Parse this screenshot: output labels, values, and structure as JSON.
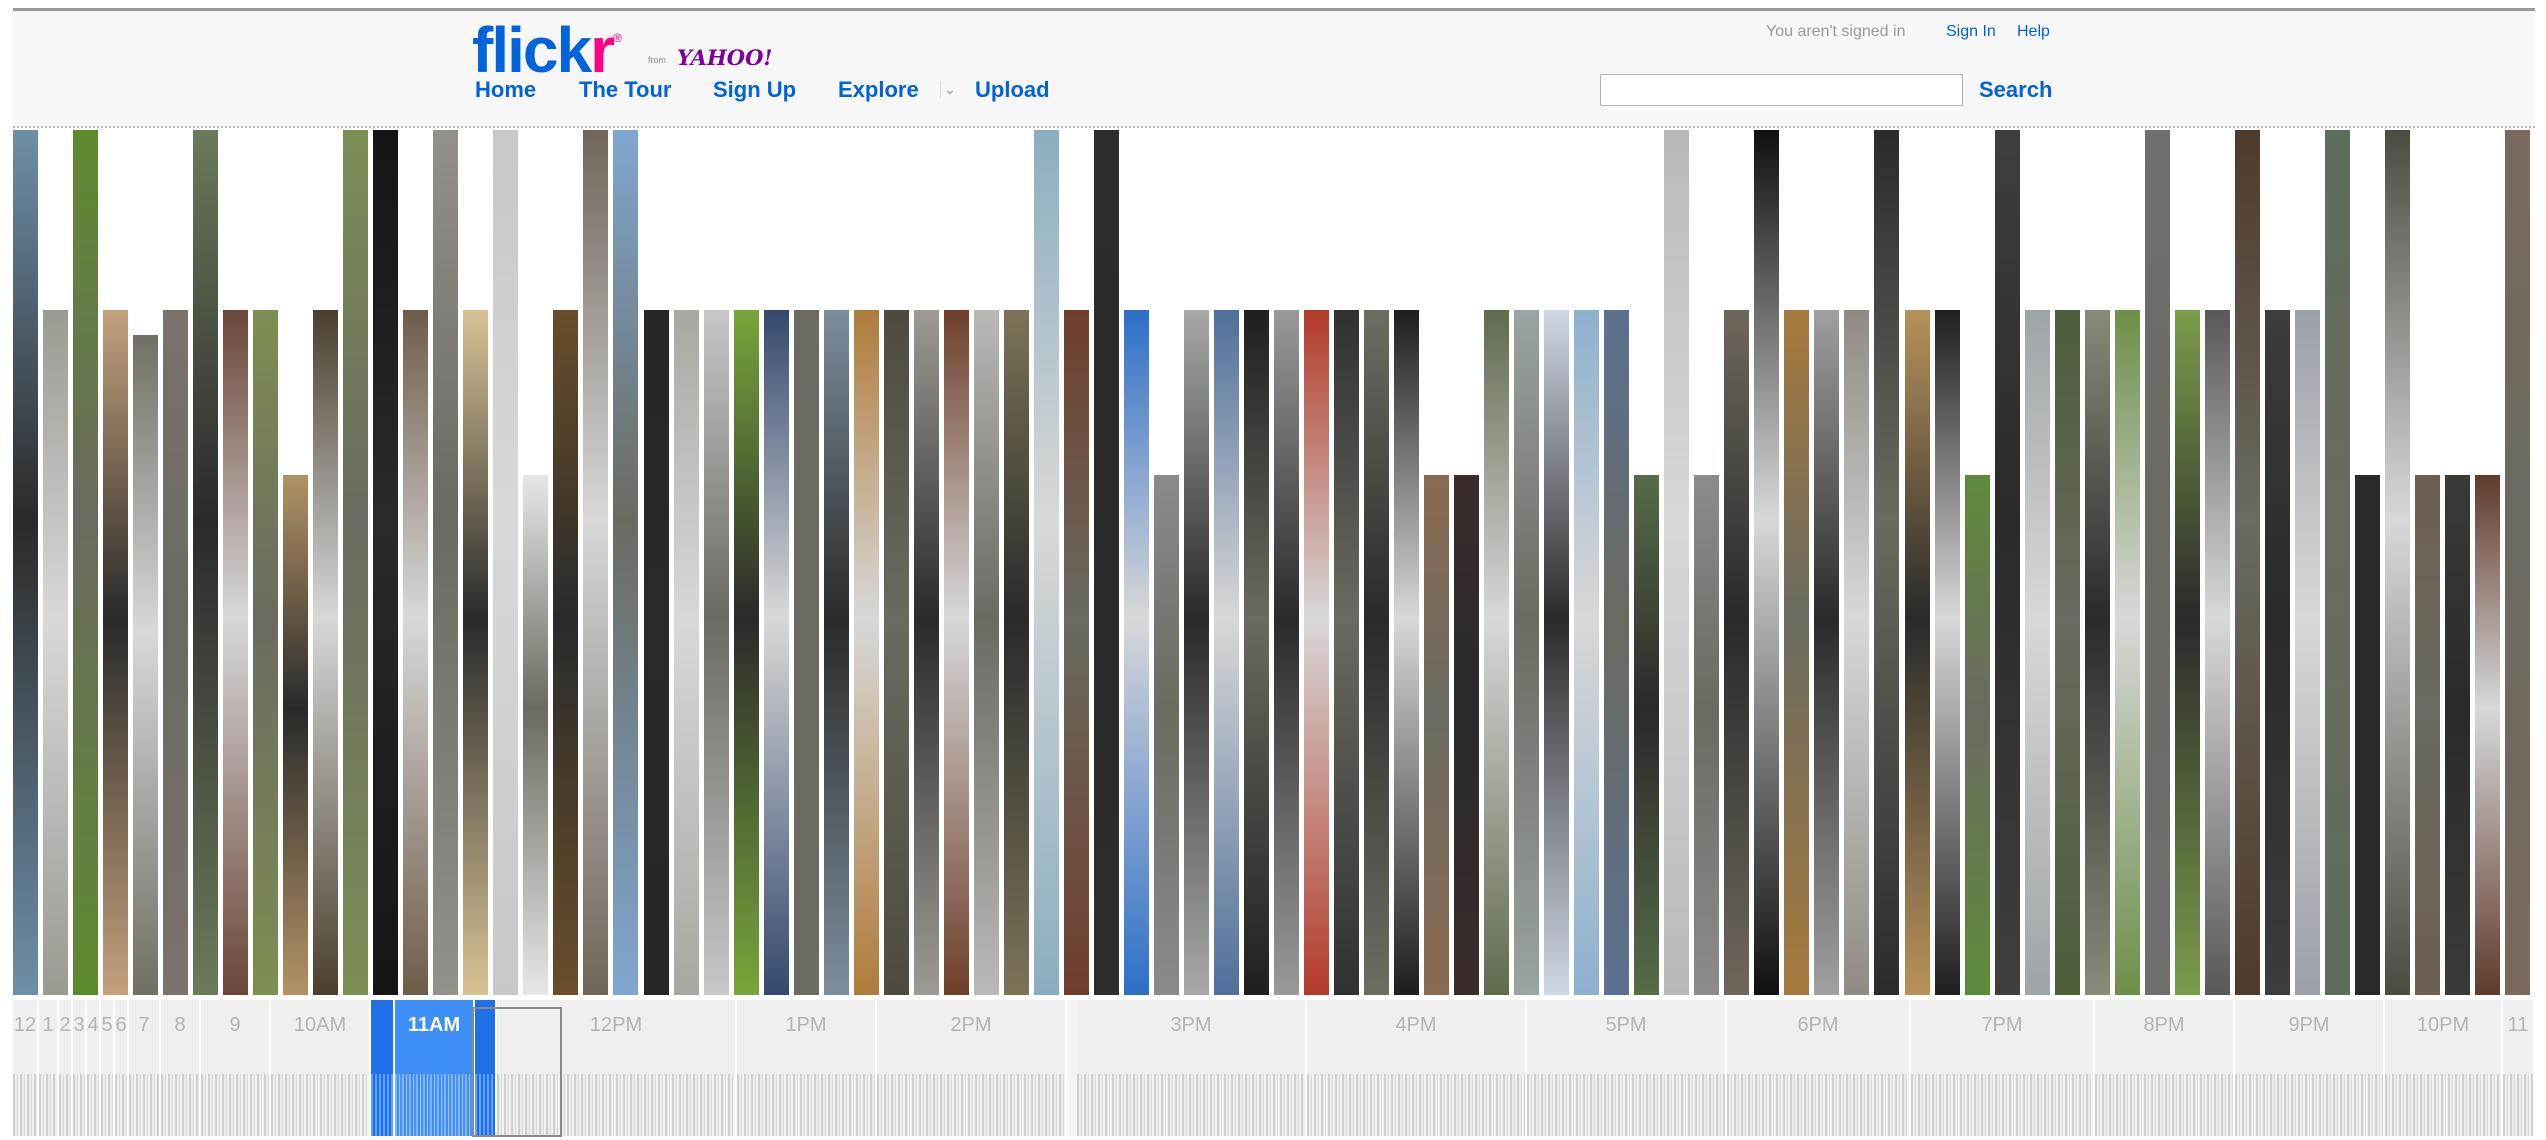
{
  "header": {
    "logo": {
      "main_blue": "flick",
      "main_pink": "r",
      "registered": "®",
      "from": "from",
      "yahoo": "YAHOO!"
    },
    "nav": [
      {
        "label": "Home"
      },
      {
        "label": "The Tour"
      },
      {
        "label": "Sign Up"
      },
      {
        "label": "Explore"
      },
      {
        "label": "Upload"
      }
    ],
    "signed_status": "You aren't signed in",
    "sign_in": "Sign In",
    "help": "Help",
    "search": {
      "value": "",
      "placeholder": "",
      "button": "Search"
    }
  },
  "timeline": {
    "selected": "11AM",
    "labels": [
      "12",
      "1",
      "2",
      "3",
      "4",
      "5",
      "6",
      "7",
      "8",
      "9",
      "10AM",
      "",
      "11AM",
      "",
      "12PM",
      "1PM",
      "2PM",
      "3PM",
      "4PM",
      "5PM",
      "6PM",
      "7PM",
      "8PM",
      "9PM",
      "10PM",
      "11"
    ]
  },
  "colors": {
    "accent": "#0063dc",
    "brand_pink": "#ff0084",
    "yahoo_purple": "#7b0099",
    "selection": "#3d8ef5"
  },
  "photo_strips": [
    "#6e8fa8",
    "#9a9a92",
    "#5e8a2e",
    "#c4a17c",
    "#6f6f64",
    "#7a726d",
    "#6a7a5a",
    "#6b4538",
    "#7d8f52",
    "#b39366",
    "#4a3f2e",
    "#7b8f55",
    "#151515",
    "#6e5c4a",
    "#95908a",
    "#d9c395",
    "#c7c7c7",
    "#e7e7e7",
    "#6a4e2b",
    "#6f655a",
    "#7fa7d1",
    "#262626",
    "#a7a9a0",
    "#c6c9c8",
    "#78a63a",
    "#34486e",
    "#6d6a60",
    "#7c8e9c",
    "#b07b3a",
    "#4e4a3f",
    "#9f9a93",
    "#6e3f2b",
    "#b9b9b6",
    "#7c7358",
    "#8aaebf",
    "#6f3e2e",
    "#2c2c2c",
    "#2d6ec7",
    "#8b8b8b",
    "#a8a8a8",
    "#4f6e9a",
    "#1f1f1f",
    "#9a9a9a",
    "#b23a28",
    "#303030",
    "#6b6f62",
    "#1d1d1d",
    "#8a6a52",
    "#3a2c2a",
    "#5f6a4e",
    "#9aa4a4",
    "#cfd8e5",
    "#8db0cf",
    "#5b6f8f",
    "#586b48",
    "#b9b9b9",
    "#8c8c8c",
    "#6e675c",
    "#0f0f0f",
    "#a67a3e",
    "#a0a0a0",
    "#8f8a84",
    "#2b2b2b",
    "#b8925a",
    "#1e1e1e",
    "#5e8b3a",
    "#3e3e3e",
    "#9da4a8",
    "#4b5e3a",
    "#8a8a7a",
    "#6c8f48",
    "#6f6f6f",
    "#7a9c4a",
    "#585858",
    "#4e3a2a",
    "#3c3c3c",
    "#9ba0a8",
    "#5d6e5c",
    "#2a2a2a",
    "#4b4b40",
    "#6d5e50",
    "#3a3a36",
    "#5f3a2c",
    "#7a6a5e"
  ]
}
